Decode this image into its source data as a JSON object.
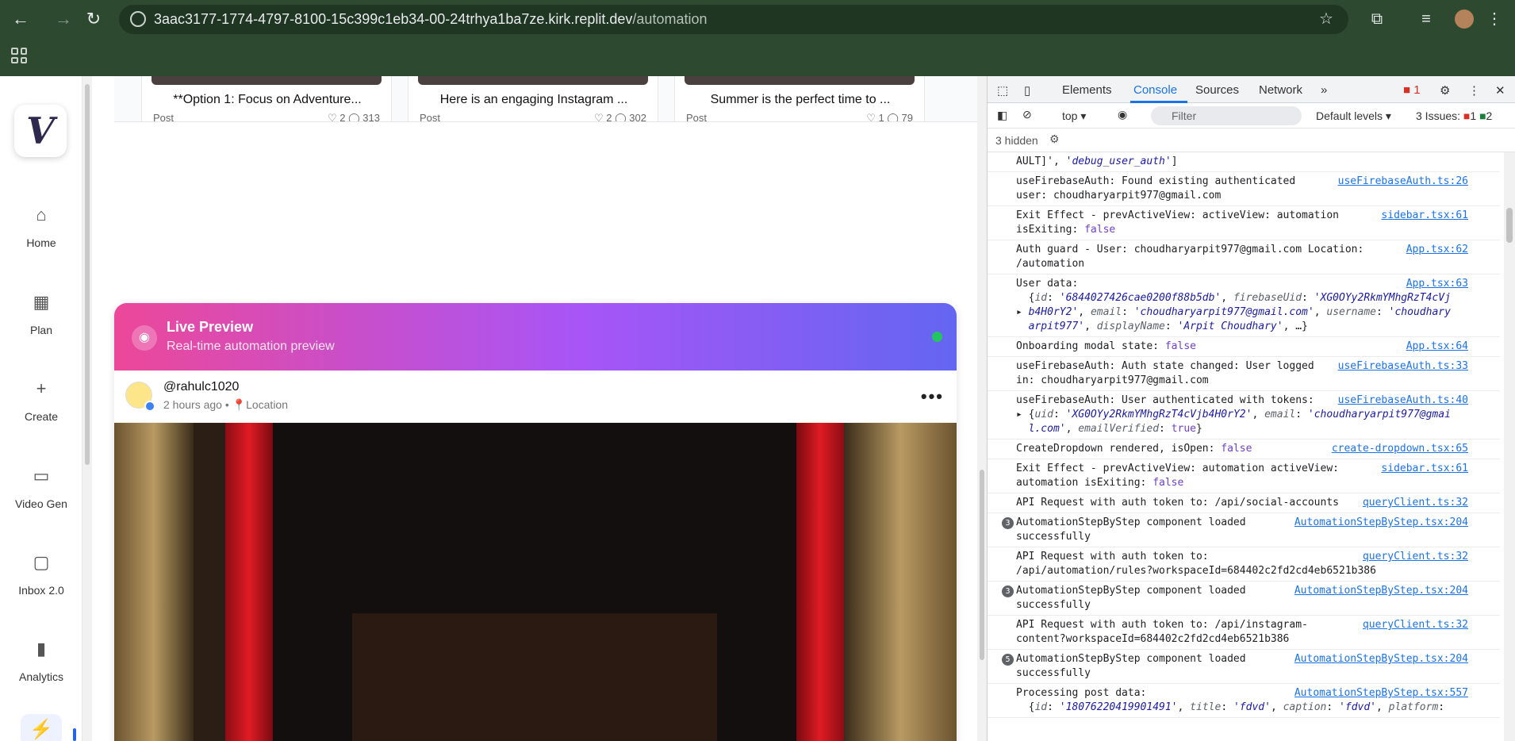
{
  "browser": {
    "url_host": "3aac3177-1774-4797-8100-15c399c1eb34-00-24trhya1ba7ze.kirk.replit.dev",
    "url_path": "/automation"
  },
  "sidebar": {
    "logo": "V",
    "items": [
      {
        "label": "Home",
        "icon": "home-icon"
      },
      {
        "label": "Plan",
        "icon": "calendar-icon"
      },
      {
        "label": "Create",
        "icon": "plus-icon"
      },
      {
        "label": "Video Gen",
        "icon": "video-icon"
      },
      {
        "label": "Inbox 2.0",
        "icon": "message-icon"
      },
      {
        "label": "Analytics",
        "icon": "bar-chart-icon"
      }
    ]
  },
  "posts": [
    {
      "title": "**Option 1: Focus on Adventure...",
      "type": "Post",
      "stats": "♡ 2  ◯ 313"
    },
    {
      "title": "Here is an engaging Instagram ...",
      "type": "Post",
      "stats": "♡ 2  ◯ 302"
    },
    {
      "title": "Summer is the perfect time to ...",
      "type": "Post",
      "stats": "♡ 1  ◯ 79"
    }
  ],
  "preview": {
    "title": "Live Preview",
    "subtitle": "Real-time automation preview",
    "username": "@rahulc1020",
    "time": "2 hours ago",
    "location": "Location"
  },
  "devtools": {
    "tabs": [
      "Elements",
      "Console",
      "Sources",
      "Network"
    ],
    "error_badge": "1",
    "context": "top",
    "filter_placeholder": "Filter",
    "levels": "Default levels",
    "issues_label": "3 Issues:",
    "issues_err": "1",
    "issues_warn": "2",
    "hidden": "3 hidden"
  },
  "console": [
    {
      "html": "AULT]', <span class='str'>'debug_user_auth'</span>]",
      "src": ""
    },
    {
      "html": "useFirebaseAuth: Found existing authenticated<br>user: choudharyarpit977@gmail.com",
      "src": "useFirebaseAuth.ts:26"
    },
    {
      "html": "Exit Effect - prevActiveView:  activeView: automation<br>isExiting: <span class='kw'>false</span>",
      "src": "sidebar.tsx:61"
    },
    {
      "html": "Auth guard - User: choudharyarpit977@gmail.com Location:<br>/automation",
      "src": "App.tsx:62"
    },
    {
      "html": "User data:<br>&nbsp;&nbsp;{<span class='prop'>id</span>: <span class='str'>'6844027426cae0200f88b5db'</span>, <span class='prop'>firebaseUid</span>: <span class='str'>'XG0OYy2RkmYMhgRzT4cVj</span><br>▸ <span class='str'>b4H0rY2'</span>, <span class='prop'>email</span>: <span class='str'>'choudharyarpit977@gmail.com'</span>, <span class='prop'>username</span>: <span class='str'>'choudhary</span><br>&nbsp;&nbsp;<span class='str'>arpit977'</span>, <span class='prop'>displayName</span>: <span class='str'>'Arpit Choudhary'</span>, …}",
      "src": "App.tsx:63"
    },
    {
      "html": "Onboarding modal state: <span class='kw'>false</span>",
      "src": "App.tsx:64"
    },
    {
      "html": "useFirebaseAuth: Auth state changed: User logged<br>in: choudharyarpit977@gmail.com",
      "src": "useFirebaseAuth.ts:33"
    },
    {
      "html": "useFirebaseAuth: User authenticated with tokens:<br>▸ {<span class='prop'>uid</span>: <span class='str'>'XG0OYy2RkmYMhgRzT4cVjb4H0rY2'</span>, <span class='prop'>email</span>: <span class='str'>'choudharyarpit977@gmai</span><br>&nbsp;&nbsp;<span class='str'>l.com'</span>, <span class='prop'>emailVerified</span>: <span class='kw'>true</span>}",
      "src": "useFirebaseAuth.ts:40"
    },
    {
      "html": "CreateDropdown rendered, isOpen: <span class='kw'>false</span>",
      "src": "create-dropdown.tsx:65"
    },
    {
      "html": "Exit Effect - prevActiveView: automation activeView:<br>automation isExiting: <span class='kw'>false</span>",
      "src": "sidebar.tsx:61"
    },
    {
      "html": "API Request with auth token to: /api/social-accounts",
      "src": "queryClient.ts:32"
    },
    {
      "html": "AutomationStepByStep component loaded<br>successfully",
      "src": "AutomationStepByStep.tsx:204",
      "count": "3"
    },
    {
      "html": "API Request with auth token to:<br>/api/automation/rules?workspaceId=684402c2fd2cd4eb6521b386",
      "src": "queryClient.ts:32"
    },
    {
      "html": "AutomationStepByStep component loaded<br>successfully",
      "src": "AutomationStepByStep.tsx:204",
      "count": "3"
    },
    {
      "html": "API Request with auth token to: /api/instagram-<br>content?workspaceId=684402c2fd2cd4eb6521b386",
      "src": "queryClient.ts:32"
    },
    {
      "html": "AutomationStepByStep component loaded<br>successfully",
      "src": "AutomationStepByStep.tsx:204",
      "count": "5"
    },
    {
      "html": "Processing post data:<br>&nbsp;&nbsp;{<span class='prop'>id</span>: <span class='str'>'18076220419901491'</span>, <span class='prop'>title</span>: <span class='str'>'fdvd'</span>, <span class='prop'>caption</span>: <span class='str'>'fdvd'</span>, <span class='prop'>platform</span>:",
      "src": "AutomationStepByStep.tsx:557"
    }
  ]
}
